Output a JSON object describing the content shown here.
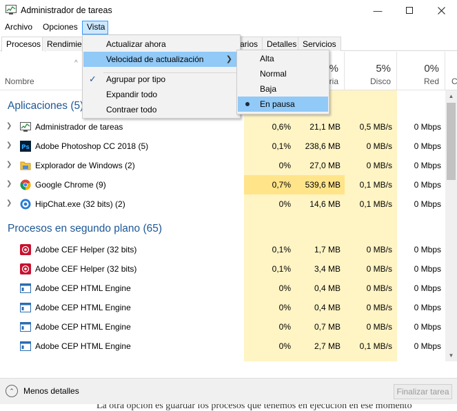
{
  "window": {
    "title": "Administrador de tareas"
  },
  "menu": {
    "archivo": "Archivo",
    "opciones": "Opciones",
    "vista": "Vista"
  },
  "tabs": {
    "procesos": "Procesos",
    "rendimiento": "Rendimien",
    "usuarios": "arios",
    "detalles": "Detalles",
    "servicios": "Servicios"
  },
  "columns": {
    "name": "Nombre",
    "cpu_pct": "",
    "mem_pct": "2%",
    "mem_label": "ria",
    "disk_pct": "5%",
    "disk_label": "Disco",
    "net_pct": "0%",
    "net_label": "Red",
    "extra_label": "C"
  },
  "vista_menu": {
    "actualizar": "Actualizar ahora",
    "velocidad": "Velocidad de actualización",
    "agrupar": "Agrupar por tipo",
    "expandir": "Expandir todo",
    "contraer": "Contraer todo"
  },
  "velocidad_submenu": {
    "alta": "Alta",
    "normal": "Normal",
    "baja": "Baja",
    "pausa": "En pausa"
  },
  "groups": {
    "apps": "Aplicaciones (5)",
    "background": "Procesos en segundo plano (65)"
  },
  "apps": [
    {
      "name": "Administrador de tareas",
      "cpu": "0,6%",
      "mem": "21,1 MB",
      "disk": "0,5 MB/s",
      "net": "0 Mbps",
      "icon": "task-manager-icon"
    },
    {
      "name": "Adobe Photoshop CC 2018 (5)",
      "cpu": "0,1%",
      "mem": "238,6 MB",
      "disk": "0 MB/s",
      "net": "0 Mbps",
      "icon": "photoshop-icon"
    },
    {
      "name": "Explorador de Windows (2)",
      "cpu": "0%",
      "mem": "27,0 MB",
      "disk": "0 MB/s",
      "net": "0 Mbps",
      "icon": "folder-icon"
    },
    {
      "name": "Google Chrome (9)",
      "cpu": "0,7%",
      "mem": "539,6 MB",
      "disk": "0,1 MB/s",
      "net": "0 Mbps",
      "icon": "chrome-icon"
    },
    {
      "name": "HipChat.exe (32 bits) (2)",
      "cpu": "0%",
      "mem": "14,6 MB",
      "disk": "0,1 MB/s",
      "net": "0 Mbps",
      "icon": "hipchat-icon"
    }
  ],
  "background": [
    {
      "name": "Adobe CEF Helper (32 bits)",
      "cpu": "0,1%",
      "mem": "1,7 MB",
      "disk": "0 MB/s",
      "net": "0 Mbps",
      "icon": "adobe-cef-icon"
    },
    {
      "name": "Adobe CEF Helper (32 bits)",
      "cpu": "0,1%",
      "mem": "3,4 MB",
      "disk": "0 MB/s",
      "net": "0 Mbps",
      "icon": "adobe-cef-icon"
    },
    {
      "name": "Adobe CEP HTML Engine",
      "cpu": "0%",
      "mem": "0,4 MB",
      "disk": "0 MB/s",
      "net": "0 Mbps",
      "icon": "app-window-icon"
    },
    {
      "name": "Adobe CEP HTML Engine",
      "cpu": "0%",
      "mem": "0,4 MB",
      "disk": "0 MB/s",
      "net": "0 Mbps",
      "icon": "app-window-icon"
    },
    {
      "name": "Adobe CEP HTML Engine",
      "cpu": "0%",
      "mem": "0,7 MB",
      "disk": "0 MB/s",
      "net": "0 Mbps",
      "icon": "app-window-icon"
    },
    {
      "name": "Adobe CEP HTML Engine",
      "cpu": "0%",
      "mem": "2,7 MB",
      "disk": "0,1 MB/s",
      "net": "0 Mbps",
      "icon": "app-window-icon"
    }
  ],
  "footer": {
    "less_details": "Menos detalles",
    "end_task": "Finalizar tarea"
  },
  "article_text": "La otra opción es guardar los procesos que tenemos en ejecución en ese momento",
  "colors": {
    "heat": "#fff4c4",
    "heat_high": "#ffe48a",
    "menu_hover": "#91c9f7",
    "group_text": "#1c5796"
  }
}
